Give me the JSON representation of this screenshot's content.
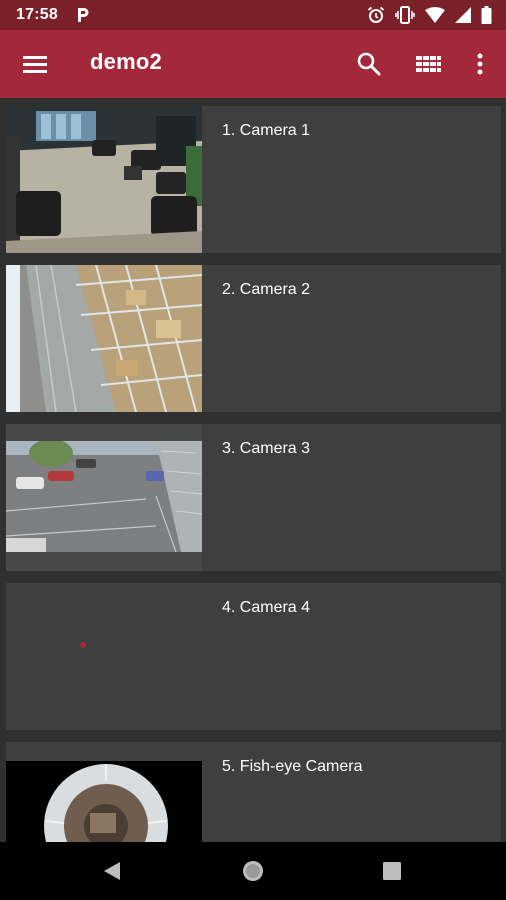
{
  "status_bar": {
    "time": "17:58",
    "icons": [
      "parking-icon",
      "alarm-icon",
      "vibrate-icon",
      "wifi-icon",
      "cell-signal-icon",
      "battery-icon"
    ]
  },
  "app_bar": {
    "title": "demo2",
    "icons": [
      "menu-icon",
      "search-icon",
      "grid-view-icon",
      "more-vert-icon"
    ]
  },
  "cameras": [
    {
      "label": "1. Camera 1"
    },
    {
      "label": "2. Camera 2"
    },
    {
      "label": "3. Camera 3"
    },
    {
      "label": "4. Camera 4"
    },
    {
      "label": "5. Fish-eye Camera"
    }
  ],
  "nav_bar": {
    "icons": [
      "back-icon",
      "home-icon",
      "recents-icon"
    ]
  },
  "colors": {
    "status_bar": "#7a2028",
    "app_bar": "#a3293a",
    "background": "#303030",
    "card": "#3f3f3f"
  }
}
